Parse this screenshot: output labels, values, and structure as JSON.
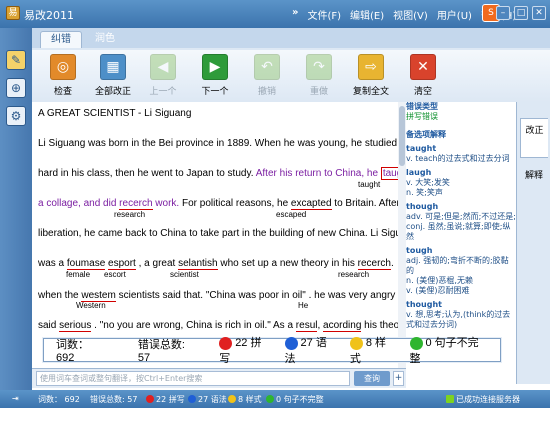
{
  "window": {
    "title": "易改2011"
  },
  "menu": [
    "文件(F)",
    "编辑(E)",
    "视图(V)",
    "用户(U)",
    "帮助(H)"
  ],
  "tabs": [
    "纠错",
    "润色"
  ],
  "toolbar": [
    {
      "label": "检查",
      "icon": "magnifier-icon",
      "color": "#e28a2a",
      "glyph": "◎"
    },
    {
      "label": "全部改正",
      "icon": "apply-all-icon",
      "color": "#4d8fc8",
      "glyph": "▦"
    },
    {
      "label": "上一个",
      "icon": "previous-icon",
      "color": "#8cc36a",
      "glyph": "◀"
    },
    {
      "label": "下一个",
      "icon": "next-icon",
      "color": "#2e9b3a",
      "glyph": "▶"
    },
    {
      "label": "撤销",
      "icon": "undo-icon",
      "color": "#8cc36a",
      "glyph": "↶"
    },
    {
      "label": "重做",
      "icon": "redo-icon",
      "color": "#8cc36a",
      "glyph": "↷"
    },
    {
      "label": "复制全文",
      "icon": "copy-all-icon",
      "color": "#e8b431",
      "glyph": "⇨"
    },
    {
      "label": "清空",
      "icon": "clear-icon",
      "color": "#d9432c",
      "glyph": "✕"
    }
  ],
  "document": {
    "title": "A GREAT SCIENTIST - Li Siguang",
    "l1": "Li Siguang was born in the Bei province in 1889. When he was young, he studied",
    "l2a": "hard in his class, then he went to Japan to study. ",
    "l2b": "After his return to China, he ",
    "l2c": "taugh",
    "l2h": "taught",
    "l3a": "a collage, and did ",
    "l3b": "recerch",
    "l3c": " work.",
    "l3d": " For political reasons, he ",
    "l3e": "excapted",
    "l3f": " to Britain. After",
    "l3h1": "research",
    "l3h2": "escaped",
    "l4": "liberation, he came back to China to take part in the building of new China. Li Siguang",
    "l5a": "was a ",
    "l5b": "foumase",
    "l5c": " ",
    "l5d": "esport",
    "l5e": " , a great ",
    "l5f": "selantish",
    "l5g": " who set up a new theory in his ",
    "l5h": "recerch",
    "l5i": ".",
    "l5h1": "female",
    "l5h2": "escort",
    "l5h3": "scientist",
    "l5h4": "research",
    "l6a": "when the ",
    "l6b": "westem",
    "l6c": " scientists said that. \"China was poor in oil\" . he was very angry and",
    "l6h1": "Western",
    "l6h2": "He",
    "l7a": "said ",
    "l7b": "serious",
    "l7c": " . \"no you are wrong, China is rich in oil.\" As a ",
    "l7d": "resul",
    "l7e": ", ",
    "l7f": "acording",
    "l7g": " his theory,"
  },
  "side": {
    "type_label": "错误类型",
    "type_value": "拼写错误",
    "alt_label": "备选项解释",
    "entries": [
      {
        "word": "taught",
        "def": [
          "v. teach的过去式和过去分词"
        ]
      },
      {
        "word": "laugh",
        "def": [
          "v. 大笑;发笑",
          "n. 笑;笑声"
        ]
      },
      {
        "word": "though",
        "def": [
          "adv. 可是;但是;然而;不过还是;",
          "conj. 虽然;虽说;就算;即使;纵然"
        ]
      },
      {
        "word": "tough",
        "def": [
          "adj. 强韧的;弯折不断的;胶黏的",
          "n. (美俚)恶棍,无赖",
          "v. (美俚)忍耐困难"
        ]
      },
      {
        "word": "thought",
        "def": [
          "v. 想,思考;认为,(think的过去式和过去分词)"
        ]
      }
    ]
  },
  "side_tabs": [
    "改正",
    "解释"
  ],
  "popup": {
    "words_label": "词数：",
    "words": "692",
    "errors_label": "错误总数:",
    "errors": "57",
    "spell": "22 拼写",
    "grammar": "27 语法",
    "style": "8 样式",
    "incomplete": "0 句子不完整",
    "colors": {
      "spell": "#e02020",
      "grammar": "#1f5fd6",
      "style": "#f0c21a",
      "incomplete": "#2fb52f"
    }
  },
  "search": {
    "placeholder": "使用词车查词或整句翻译，按Ctrl+Enter搜索",
    "button": "查询",
    "plus": "+"
  },
  "status": {
    "words_label": "词数：",
    "words": "692",
    "errors": "错误总数: 57",
    "spell": "22 拼写",
    "grammar": "27 语法",
    "style": "8 样式",
    "incomplete": "0 句子不完整",
    "server": "已成功连接服务器"
  }
}
